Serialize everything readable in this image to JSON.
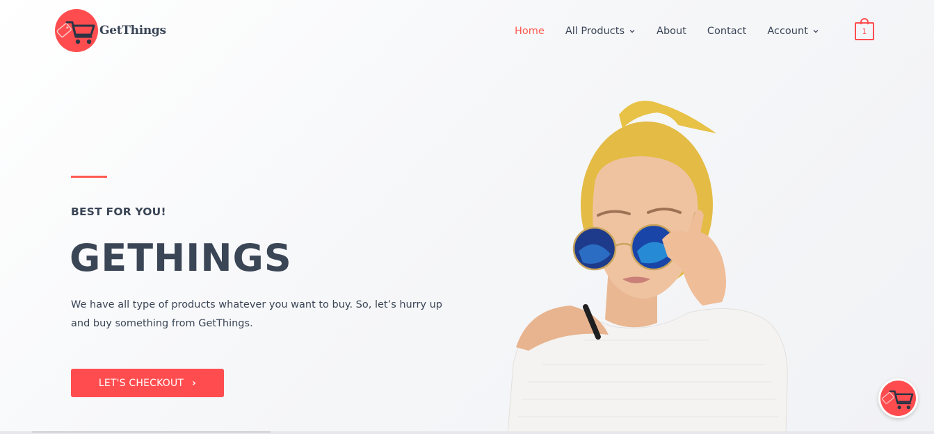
{
  "brand": {
    "name": "GetThings",
    "accent": "#ff4d4f",
    "text_color": "#3a4556"
  },
  "nav": {
    "items": [
      {
        "label": "Home",
        "active": true,
        "has_dropdown": false
      },
      {
        "label": "All Products",
        "active": false,
        "has_dropdown": true
      },
      {
        "label": "About",
        "active": false,
        "has_dropdown": false
      },
      {
        "label": "Contact",
        "active": false,
        "has_dropdown": false
      },
      {
        "label": "Account",
        "active": false,
        "has_dropdown": true
      }
    ],
    "cart_count": "1"
  },
  "hero": {
    "eyebrow": "BEST FOR YOU!",
    "title": "GETHINGS",
    "description": "We have all type of products whatever you want to buy. So, let’s hurry up and buy something from GetThings.",
    "cta_label": "LET'S CHECKOUT",
    "cta_icon": "chevron-right-icon"
  },
  "icons": {
    "logo": "shopping-cart-icon",
    "cart": "shopping-bag-icon",
    "floating": "shopping-cart-icon"
  }
}
